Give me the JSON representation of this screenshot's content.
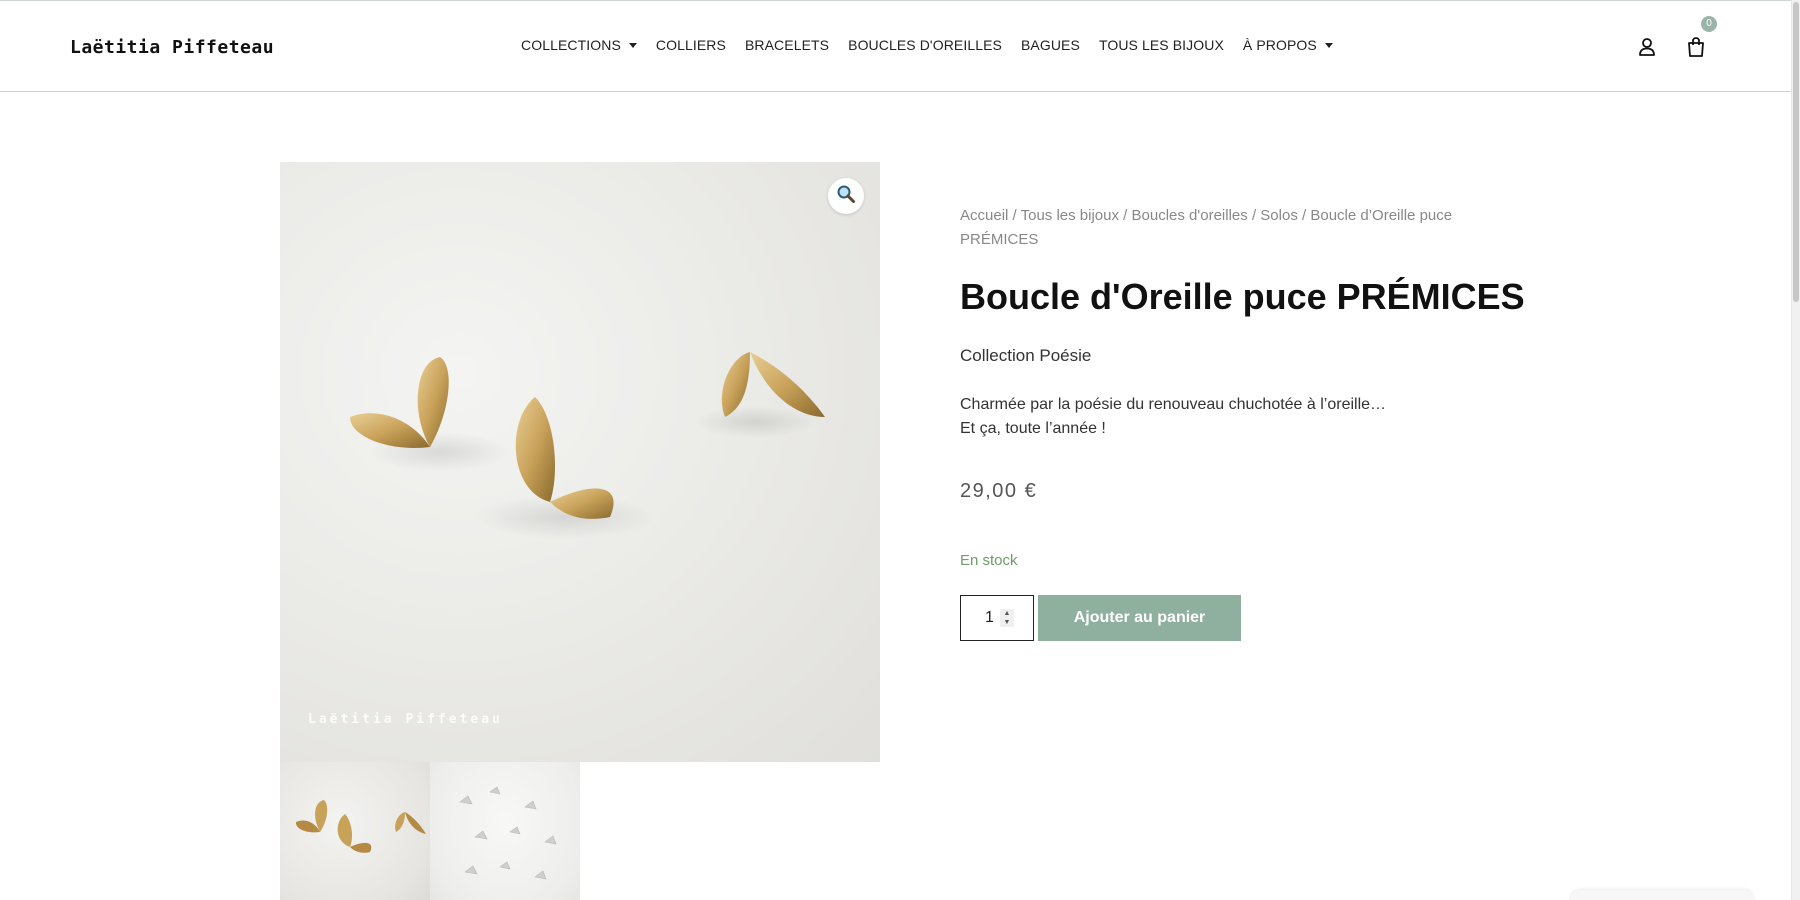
{
  "header": {
    "logo": "Laëtitia Piffeteau",
    "nav": [
      {
        "label": "COLLECTIONS",
        "has_dropdown": true
      },
      {
        "label": "COLLIERS",
        "has_dropdown": false
      },
      {
        "label": "BRACELETS",
        "has_dropdown": false
      },
      {
        "label": "BOUCLES D'OREILLES",
        "has_dropdown": false
      },
      {
        "label": "BAGUES",
        "has_dropdown": false
      },
      {
        "label": "TOUS LES BIJOUX",
        "has_dropdown": false
      },
      {
        "label": "À PROPOS",
        "has_dropdown": true
      }
    ],
    "account_icon": "user-icon",
    "cart_icon": "shopping-bag-icon",
    "cart_count": "0"
  },
  "gallery": {
    "zoom_icon": "magnifier-icon",
    "watermark": "Laëtitia Piffeteau"
  },
  "product": {
    "breadcrumb": [
      "Accueil",
      "Tous les bijoux",
      "Boucles d'oreilles",
      "Solos",
      "Boucle d’Oreille puce PRÉMICES"
    ],
    "title": "Boucle d'Oreille puce PRÉMICES",
    "collection": "Collection Poésie",
    "description_line1": "Charmée par la poésie du renouveau chuchotée à l’oreille…",
    "description_line2": "Et ça, toute l’année !",
    "price": "29,00 €",
    "stock": "En stock",
    "quantity": "1",
    "add_to_cart": "Ajouter au panier"
  },
  "colors": {
    "accent": "#8fb09f",
    "stock_green": "#6e9d68",
    "badge": "#9ab5a8"
  }
}
